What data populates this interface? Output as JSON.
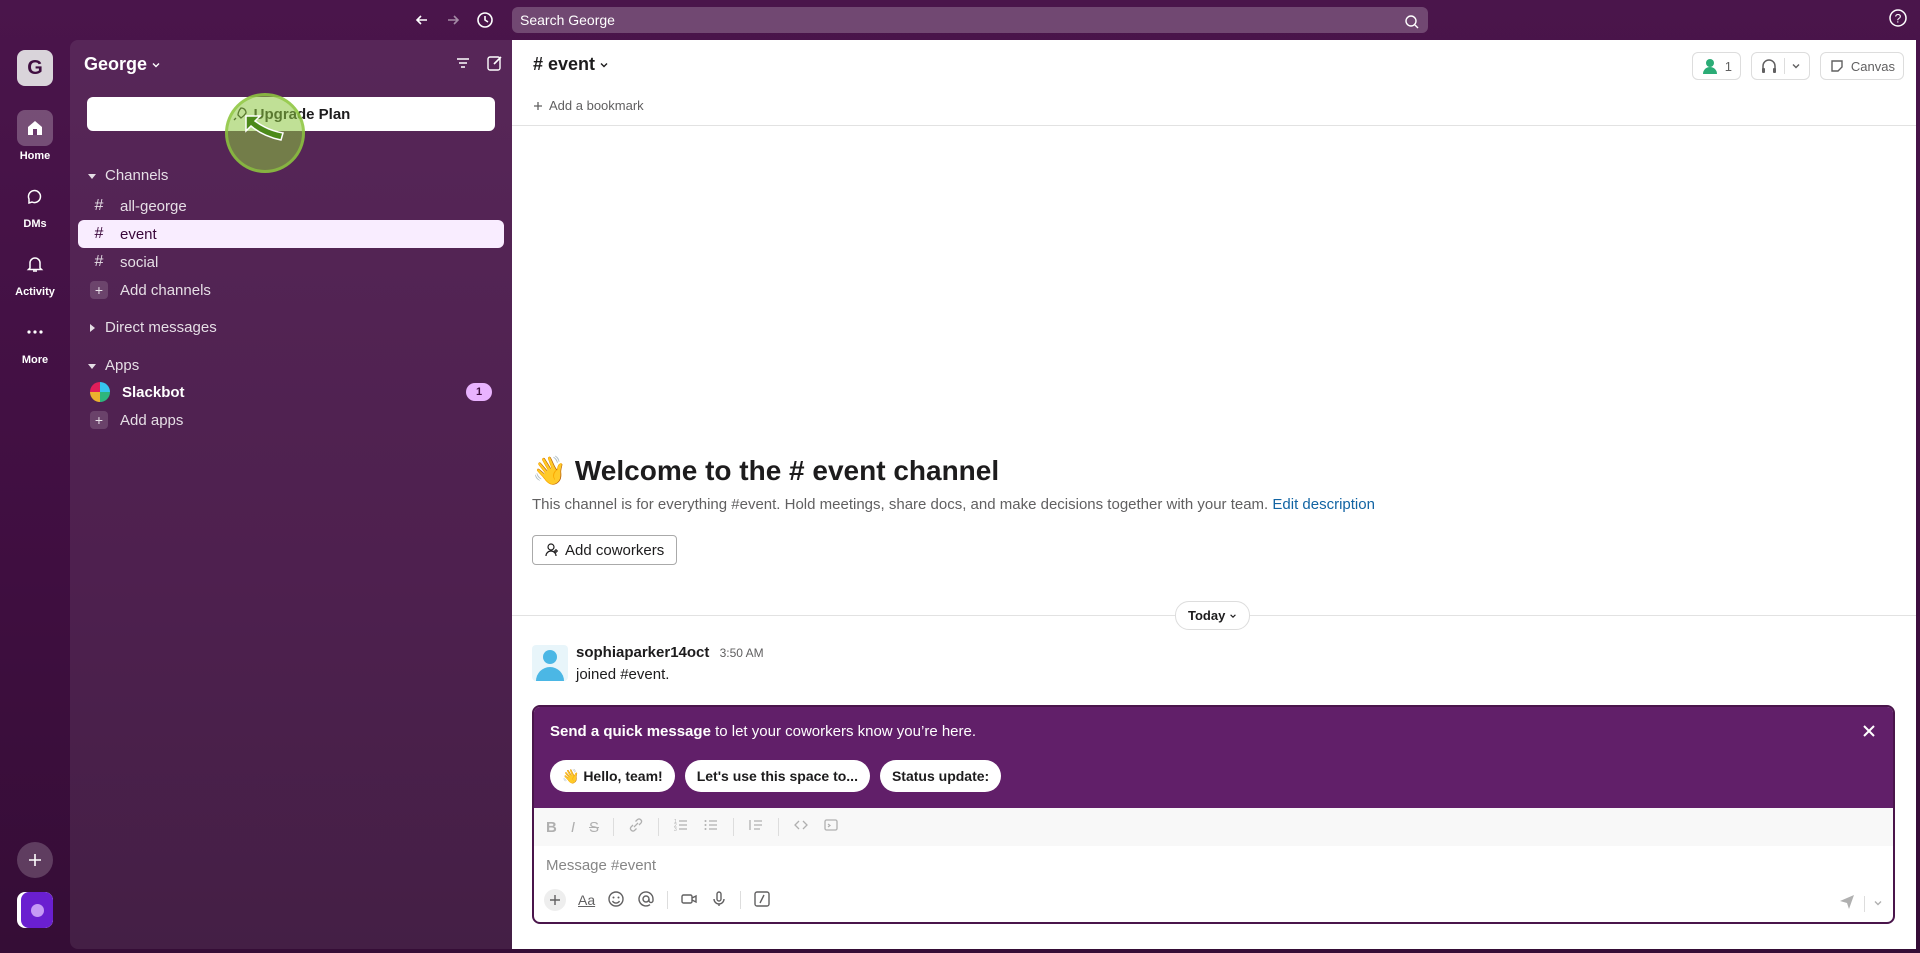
{
  "topbar": {
    "search_placeholder": "Search George"
  },
  "rail": {
    "workspace_initial": "G",
    "items": [
      {
        "label": "Home",
        "icon": "home-icon"
      },
      {
        "label": "DMs",
        "icon": "dms-icon"
      },
      {
        "label": "Activity",
        "icon": "bell-icon"
      },
      {
        "label": "More",
        "icon": "more-icon"
      }
    ]
  },
  "sidebar": {
    "workspace_name": "George",
    "upgrade_label": "Upgrade Plan",
    "channels_section": "Channels",
    "channels": [
      "all-george",
      "event",
      "social"
    ],
    "add_channels": "Add channels",
    "dm_section": "Direct messages",
    "apps_section": "Apps",
    "apps": [
      {
        "name": "Slackbot",
        "badge": "1"
      }
    ],
    "add_apps": "Add apps"
  },
  "main": {
    "channel_name": "# event",
    "add_bookmark": "Add a bookmark",
    "members_count": "1",
    "canvas_label": "Canvas",
    "welcome_title": "Welcome to the # event channel",
    "welcome_desc": "This channel is for everything #event. Hold meetings, share docs, and make decisions together with your team.",
    "edit_description": "Edit description",
    "add_coworkers": "Add coworkers",
    "date_divider": "Today",
    "message": {
      "user": "sophiaparker14oct",
      "time": "3:50 AM",
      "text": "joined #event."
    }
  },
  "composer": {
    "prompt_bold": "Send a quick message",
    "prompt_rest": " to let your coworkers know you’re here.",
    "chips": [
      "👋 Hello, team!",
      "Let's use this space to...",
      "Status update:"
    ],
    "placeholder": "Message #event"
  },
  "colors": {
    "sidebar_bg": "#4a154b",
    "active_channel_bg": "#f9edff",
    "prompt_bg": "#611f69",
    "link": "#1264a3",
    "tutorial_pointer": "#8dc63f"
  }
}
